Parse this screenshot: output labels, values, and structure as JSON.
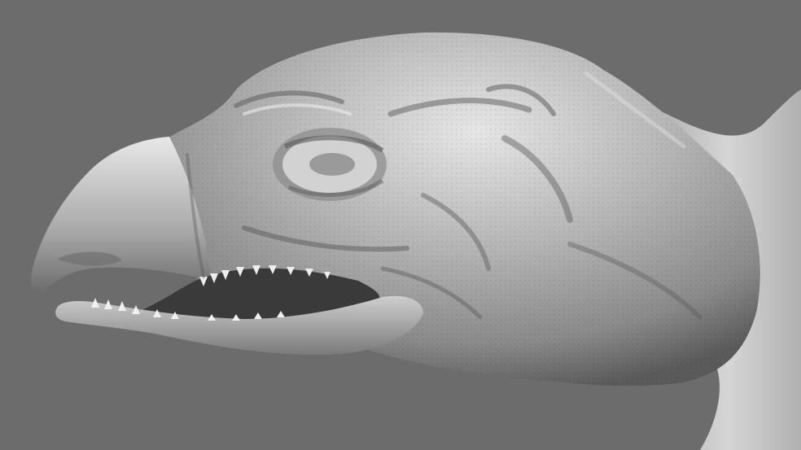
{
  "viewport": {
    "background_color": "#6c6c6c",
    "model_base_color": "#a9a9a9",
    "model_highlight_color": "#e4e4e4",
    "model_shadow_color": "#3e3e3e",
    "model_icon": "sculpted-creature-head-icon"
  }
}
